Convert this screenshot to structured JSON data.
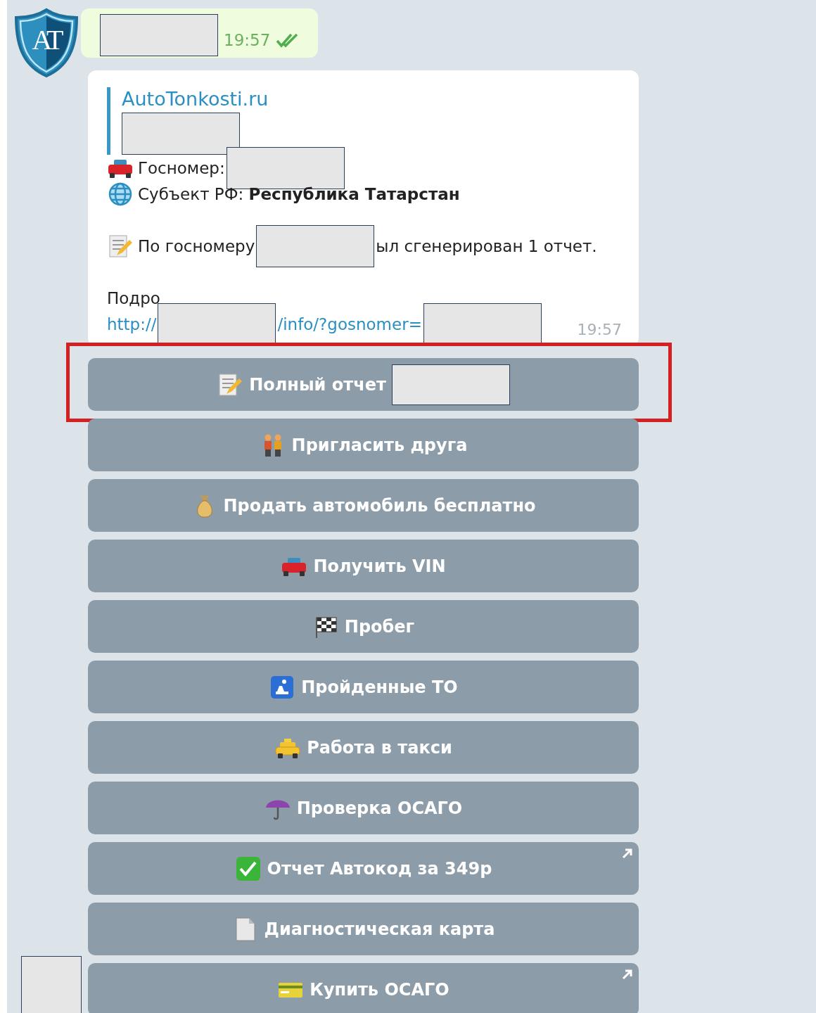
{
  "avatar": {
    "initials": "AT"
  },
  "outgoing": {
    "parts": [
      {
        "kind": "redacted"
      }
    ],
    "time": "19:57",
    "read": true
  },
  "incoming": {
    "preview": {
      "site": "AutoTonkosti.ru",
      "parts": [
        {
          "kind": "redacted"
        }
      ]
    },
    "paragraphs": [
      [
        {
          "icon": true,
          "parts": [
            {
              "kind": "text",
              "text": "Госномер:"
            },
            {
              "kind": "redacted"
            }
          ]
        },
        {
          "icon": true,
          "parts": [
            {
              "kind": "text",
              "text": "Субъект РФ: **Республика Татарстан**"
            }
          ]
        }
      ],
      [
        {
          "icon": true,
          "parts": [
            {
              "kind": "text",
              "text": "По госномеру"
            },
            {
              "kind": "redacted"
            },
            {
              "kind": "text",
              "text": "ыл сгенерирован 1 отчет."
            }
          ]
        }
      ],
      [
        {
          "icon": false,
          "parts": [
            {
              "kind": "text",
              "text": "Подро"
            }
          ]
        },
        {
          "icon": false,
          "parts": [
            {
              "kind": "link",
              "text": "http://"
            },
            {
              "kind": "redacted"
            },
            {
              "kind": "link",
              "text": "/info/?gosnomer="
            },
            {
              "kind": "redacted"
            }
          ]
        }
      ]
    ],
    "time": "19:57"
  },
  "buttons": [
    {
      "label": "Полный отчет",
      "redacted_after": true,
      "external": false,
      "highlighted": true
    },
    {
      "label": "Пригласить друга",
      "redacted_after": false,
      "external": false,
      "highlighted": false
    },
    {
      "label": "Продать автомобиль бесплатно",
      "redacted_after": false,
      "external": false,
      "highlighted": false
    },
    {
      "label": "Получить VIN",
      "redacted_after": false,
      "external": false,
      "highlighted": false
    },
    {
      "label": "Пробег",
      "redacted_after": false,
      "external": false,
      "highlighted": false
    },
    {
      "label": "Пройденные ТО",
      "redacted_after": false,
      "external": false,
      "highlighted": false
    },
    {
      "label": "Работа в такси",
      "redacted_after": false,
      "external": false,
      "highlighted": false
    },
    {
      "label": "Проверка ОСАГО",
      "redacted_after": false,
      "external": false,
      "highlighted": false
    },
    {
      "label": "Отчет Автокод за 349р",
      "redacted_after": false,
      "external": true,
      "highlighted": false
    },
    {
      "label": "Диагностическая карта",
      "redacted_after": false,
      "external": false,
      "highlighted": false
    },
    {
      "label": "Купить ОСАГО",
      "redacted_after": false,
      "external": true,
      "highlighted": false
    }
  ],
  "sender_placeholder": {
    "redacted": true
  }
}
